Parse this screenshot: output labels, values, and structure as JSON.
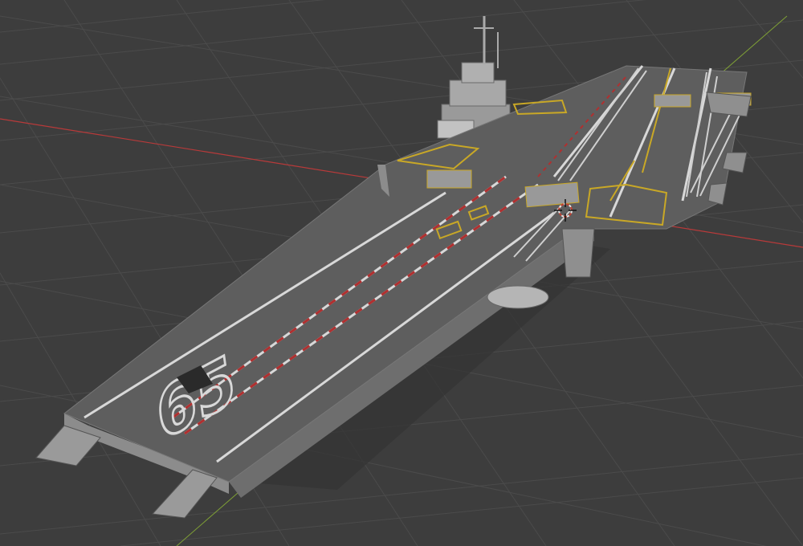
{
  "viewport": {
    "background": "#3d3d3d",
    "grid_color": "#4a4a4a",
    "x_axis_color": "#b83a3a",
    "y_axis_color": "#7fa036"
  },
  "model": {
    "hull_number": "65",
    "deck_color": "#5e5e5e",
    "side_color": "#8c8c8c",
    "marking_white": "#d8d8d8",
    "marking_yellow": "#c9a826",
    "marking_red": "#b03030"
  },
  "cursor": {
    "icon": "3d-cursor-icon"
  }
}
